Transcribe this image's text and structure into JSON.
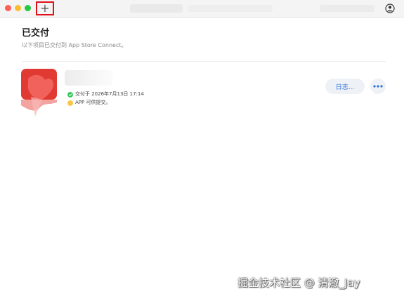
{
  "window": {
    "toolbar": {
      "add_label": "+"
    }
  },
  "archives": {
    "section_title": "已交付",
    "section_subtitle": "以下项目已交付到 App Store Connect。",
    "items": [
      {
        "delivered_text": "交付于 2026年7月13日 17:14",
        "availability_text": "APP 可供提交。",
        "log_button_label": "日志...",
        "more_icon": "ellipsis-icon"
      }
    ]
  },
  "colors": {
    "accent_blue": "#2d72d9",
    "status_green": "#34c759",
    "status_yellow": "#f7c94b",
    "highlight_red": "#e0111a",
    "app_icon_red": "#e13a33"
  },
  "watermark": {
    "text": "掘金技术社区 @ 清澈_Jay"
  }
}
